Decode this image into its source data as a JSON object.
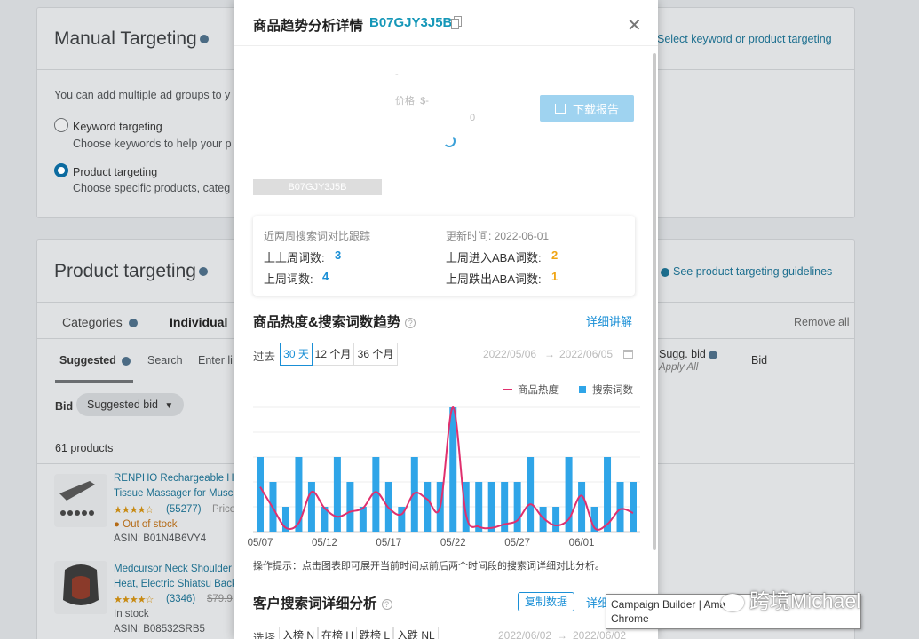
{
  "background": {
    "manual_targeting": {
      "title": "Manual Targeting",
      "link": "Select keyword or product targeting",
      "intro": "You can add multiple ad groups to y",
      "keyword_option": "Keyword targeting",
      "keyword_desc": "Choose keywords to help your p",
      "product_option": "Product targeting",
      "product_desc": "Choose specific products, categ"
    },
    "product_targeting": {
      "title": "Product targeting",
      "guidelines_link": "See product targeting guidelines",
      "tabs": [
        "Categories",
        "Individual"
      ],
      "remove_all": "Remove all",
      "subtabs": [
        "Suggested",
        "Search",
        "Enter li"
      ],
      "sugg_bid_header": "Sugg. bid",
      "apply_all": "Apply All",
      "bid_header": "Bid",
      "bid_label": "Bid",
      "bid_select": "Suggested bid",
      "count": "61 products",
      "products": [
        {
          "title1": "RENPHO Rechargeable Ha",
          "title2": "Tissue Massager for Muscl",
          "rating": "(55277)",
          "extra": "Price",
          "status": "Out of stock",
          "asin": "ASIN: B01N4B6VY4"
        },
        {
          "title1": "Medcursor Neck Shoulder",
          "title2": "Heat, Electric Shiatsu Back",
          "rating": "(3346)",
          "extra": "$79.9",
          "status": "In stock",
          "asin": "ASIN: B08532SRB5"
        }
      ]
    }
  },
  "modal": {
    "title": "商品趋势分析详情",
    "asin": "B07GJY3J5B",
    "placeholder_dash": "-",
    "price": "价格: $-",
    "zero": "0",
    "download_label": "下载报告",
    "asin_bar": "B07GJY3J5B",
    "stats": {
      "compare_label": "近两周搜索词对比跟踪",
      "updated_label": "更新时间: 2022-06-01",
      "prev_prev_week": {
        "label": "上上周词数:",
        "value": "3"
      },
      "prev_week": {
        "label": "上周词数:",
        "value": "4"
      },
      "enter_aba": {
        "label": "上周进入ABA词数:",
        "value": "2"
      },
      "exit_aba": {
        "label": "上周跌出ABA词数:",
        "value": "1"
      }
    },
    "trend": {
      "title": "商品热度&搜索词数趋势",
      "detail_link": "详细讲解",
      "range_label": "过去",
      "ranges": [
        "30 天",
        "12 个月",
        "36 个月"
      ],
      "date_from": "2022/05/06",
      "date_to": "2022/06/05",
      "hint": "操作提示：点击图表即可展开当前时间点前后两个时间段的搜索词详细对比分析。"
    },
    "customer": {
      "title": "客户搜索词详细分析",
      "copy_label": "复制数据",
      "detail_link": "详细",
      "select_label": "选择",
      "tags": [
        "入榜 N",
        "在榜 H",
        "跌榜 L",
        "入跌 NL"
      ],
      "date_from": "2022/06/02",
      "date_to": "2022/06/02"
    }
  },
  "chart_data": {
    "type": "bar",
    "legend": [
      "商品热度",
      "搜索词数"
    ],
    "colors": {
      "heat": "#e0306e",
      "count": "#2fa5e8"
    },
    "x_tick_labels": [
      "05/07",
      "05/12",
      "05/17",
      "05/22",
      "05/27",
      "06/01"
    ],
    "series": [
      {
        "name": "搜索词数",
        "type": "bar",
        "values": [
          3,
          2,
          1,
          3,
          2,
          1,
          3,
          2,
          1,
          3,
          2,
          1,
          3,
          2,
          2,
          5,
          2,
          2,
          2,
          2,
          2,
          3,
          1,
          1,
          3,
          2,
          1,
          3,
          2,
          2
        ]
      },
      {
        "name": "商品热度",
        "type": "line",
        "values": [
          1.8,
          0.95,
          0.15,
          0.35,
          1.6,
          0.95,
          0.6,
          0.8,
          0.95,
          1.6,
          0.95,
          0.7,
          1.55,
          1.3,
          1.0,
          5.0,
          0.7,
          0.2,
          0.15,
          0.3,
          0.45,
          1.1,
          0.55,
          0.25,
          0.5,
          1.45,
          0.15,
          0.3,
          0.9,
          0.75
        ]
      }
    ]
  },
  "tooltip": {
    "line1": "Campaign Builder | Ama",
    "line2": "Chrome"
  },
  "watermark": "跨境Michael"
}
